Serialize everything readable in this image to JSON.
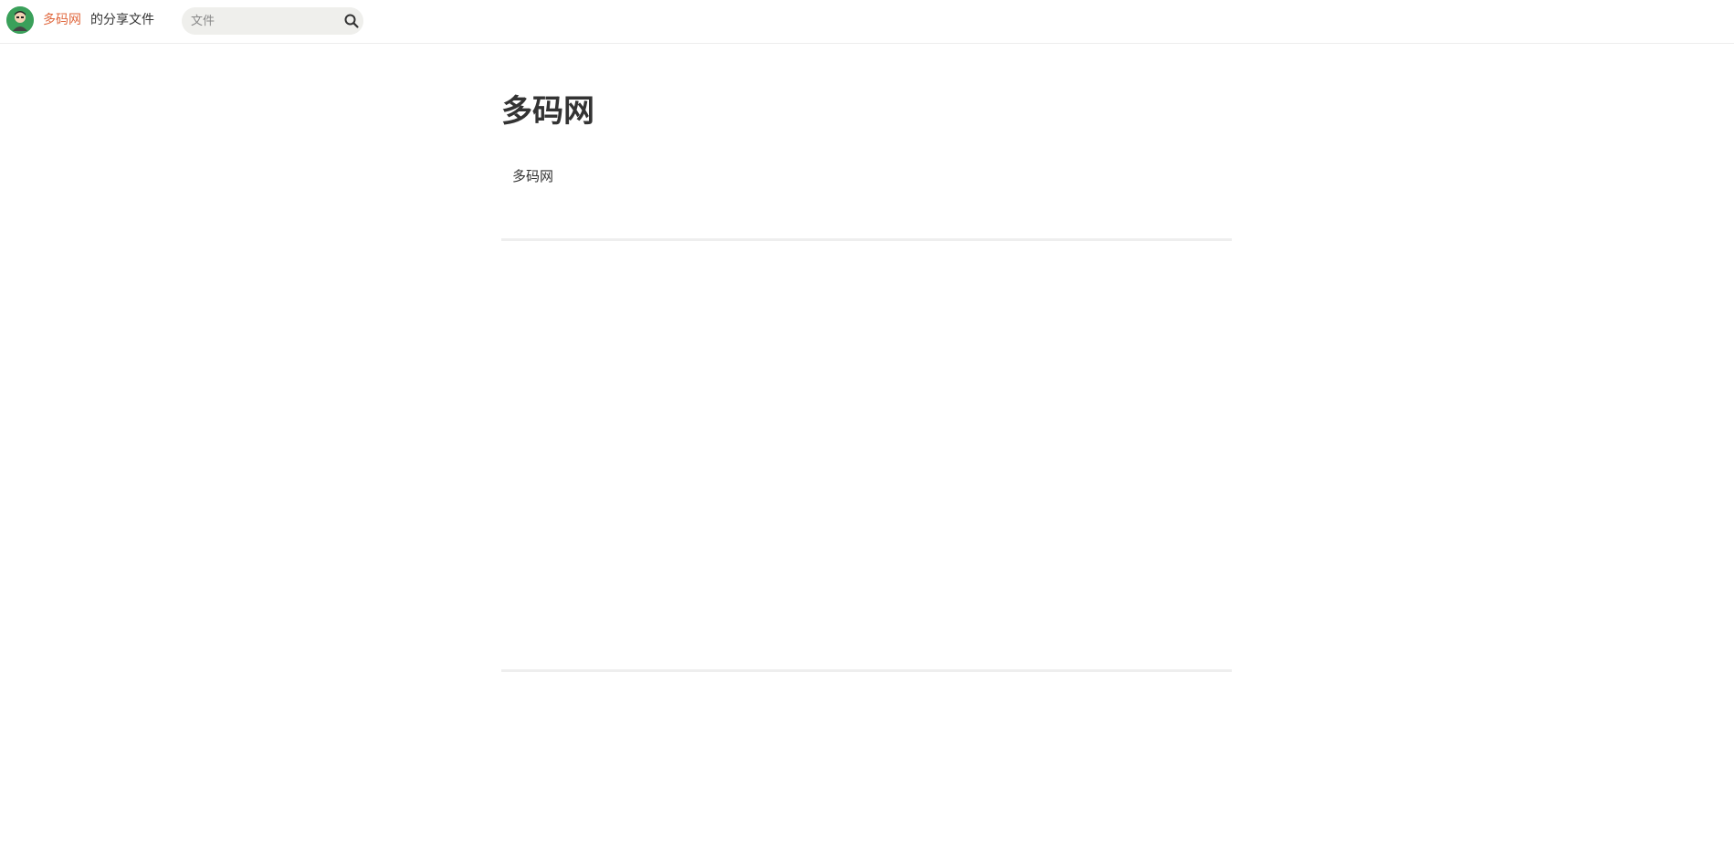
{
  "header": {
    "site_name": "多码网",
    "site_suffix": "的分享文件",
    "search": {
      "placeholder": "文件",
      "value": ""
    }
  },
  "main": {
    "title": "多码网",
    "description": "多码网"
  },
  "colors": {
    "accent": "#e0683e",
    "avatar_bg": "#3aa05a",
    "search_bg": "#efefec",
    "divider": "#eeeeee"
  },
  "icons": {
    "avatar": "user-avatar-icon",
    "search": "search-icon"
  }
}
